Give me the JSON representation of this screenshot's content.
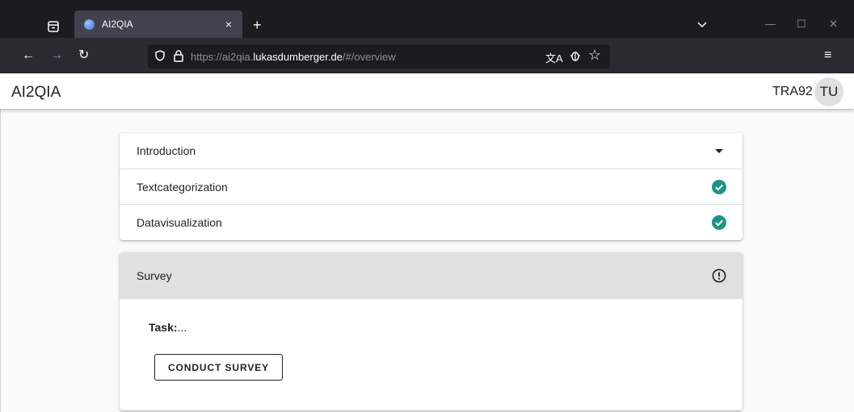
{
  "browser": {
    "tab_title": "AI2QIA",
    "tab_close": "×",
    "new_tab": "+",
    "url_prefix": "https://ai2qia.",
    "url_host": "lukasdumberger.de",
    "url_suffix": "/#/overview"
  },
  "app": {
    "title": "AI2QIA",
    "user_code": "TRA92",
    "avatar_initials": "TU"
  },
  "sections": [
    {
      "label": "Introduction",
      "status": "collapsed",
      "icon": "caret-down-icon"
    },
    {
      "label": "Textcategorization",
      "status": "completed",
      "icon": "check-circle-icon"
    },
    {
      "label": "Datavisualization",
      "status": "completed",
      "icon": "check-circle-icon"
    }
  ],
  "survey": {
    "label": "Survey",
    "status": "pending",
    "icon": "exclamation-circle-icon",
    "task_label": "Task:",
    "task_value": "...",
    "button_label": "CONDUCT SURVEY"
  },
  "colors": {
    "check": "#1a9486",
    "panel_header": "#e0e0e0"
  }
}
